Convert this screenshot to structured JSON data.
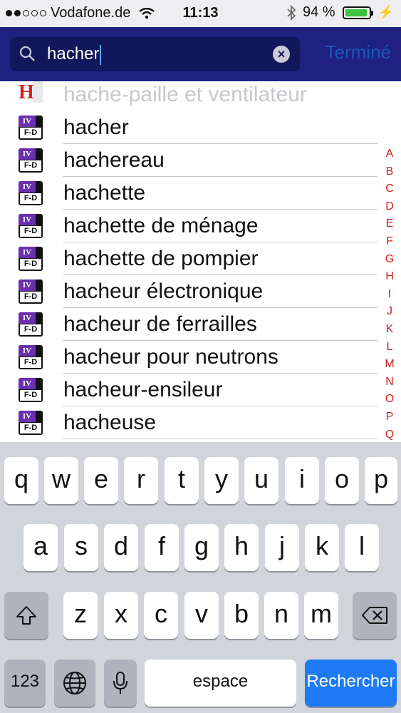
{
  "status_bar": {
    "carrier": "Vodafone.de",
    "time": "11:13",
    "battery": "94 %",
    "battery_level": 0.94
  },
  "search": {
    "query": "hacher",
    "done_label": "Terminé"
  },
  "results": [
    {
      "label": "hache-paille et ventilateur",
      "icon": "letter-h-icon",
      "faded": true
    },
    {
      "label": "hacher",
      "icon": "dictionary-fd-icon"
    },
    {
      "label": "hachereau",
      "icon": "dictionary-fd-icon"
    },
    {
      "label": "hachette",
      "icon": "dictionary-fd-icon"
    },
    {
      "label": "hachette de ménage",
      "icon": "dictionary-fd-icon"
    },
    {
      "label": "hachette de pompier",
      "icon": "dictionary-fd-icon"
    },
    {
      "label": "hacheur électronique",
      "icon": "dictionary-fd-icon"
    },
    {
      "label": "hacheur de ferrailles",
      "icon": "dictionary-fd-icon"
    },
    {
      "label": "hacheur pour neutrons",
      "icon": "dictionary-fd-icon"
    },
    {
      "label": "hacheur-ensileur",
      "icon": "dictionary-fd-icon"
    },
    {
      "label": "hacheuse",
      "icon": "dictionary-fd-icon"
    }
  ],
  "icon_text": {
    "h": "H",
    "top": "IV",
    "bottom": "F-D"
  },
  "alphabet_index": [
    "A",
    "B",
    "C",
    "D",
    "E",
    "F",
    "G",
    "H",
    "I",
    "J",
    "K",
    "L",
    "M",
    "N",
    "O",
    "P",
    "Q"
  ],
  "keyboard": {
    "row1": [
      "q",
      "w",
      "e",
      "r",
      "t",
      "y",
      "u",
      "i",
      "o",
      "p"
    ],
    "row2": [
      "a",
      "s",
      "d",
      "f",
      "g",
      "h",
      "j",
      "k",
      "l"
    ],
    "row3": [
      "z",
      "x",
      "c",
      "v",
      "b",
      "n",
      "m"
    ],
    "numbers_label": "123",
    "space_label": "espace",
    "search_label": "Rechercher"
  },
  "colors": {
    "search_bar": "#1f2080",
    "index_letters": "#d02020",
    "search_key": "#1e7af5"
  }
}
